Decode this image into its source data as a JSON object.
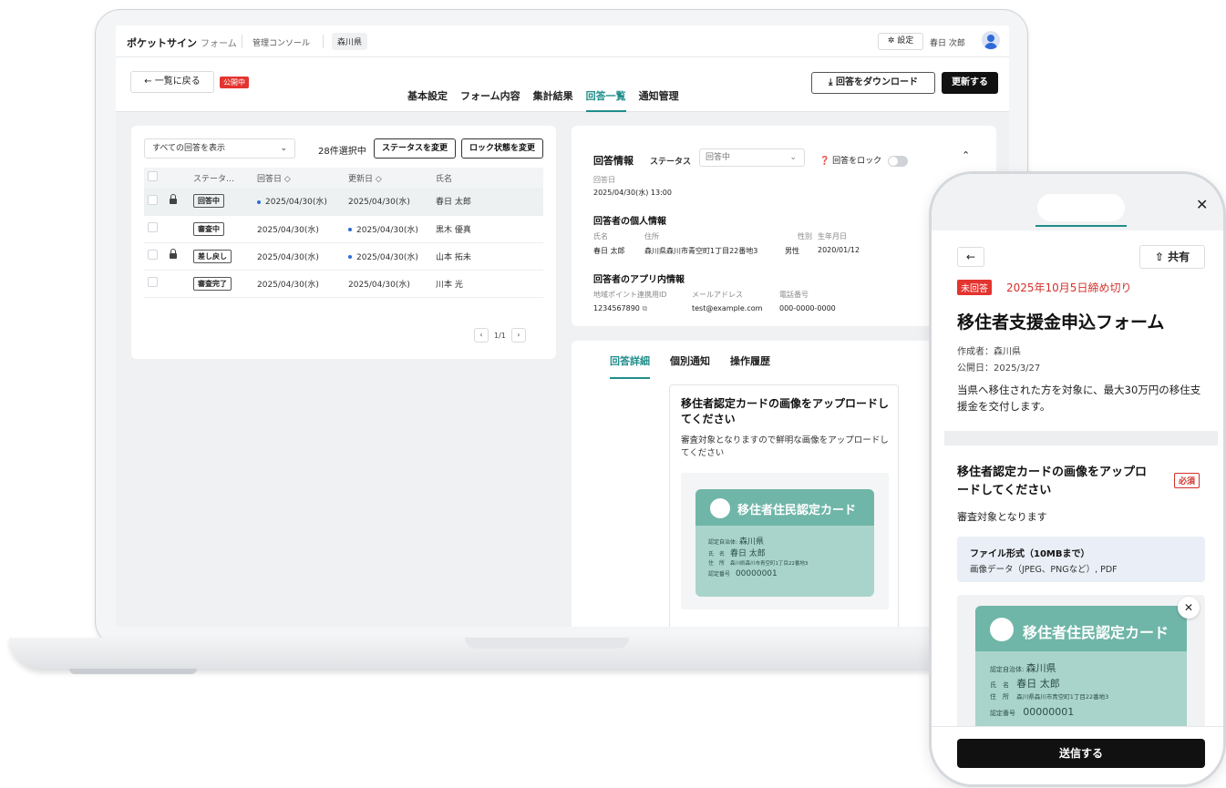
{
  "app": {
    "brand": "ポケットサイン",
    "brand_sub": "フォーム",
    "console": "管理コンソール",
    "prefecture": "森川県",
    "settings_label": "設定",
    "settings_icon": "gear-icon",
    "user_name": "春日 次郎"
  },
  "subheader": {
    "back_label": "← 一覧に戻る",
    "public_badge": "公開中",
    "tabs": [
      "基本設定",
      "フォーム内容",
      "集計結果",
      "回答一覧",
      "通知管理"
    ],
    "active_tab": "回答一覧",
    "download_label": "⤓ 回答をダウンロード",
    "update_label": "更新する"
  },
  "list": {
    "filter_value": "すべての回答を表示",
    "selected_count": "28件選択中",
    "change_status_label": "ステータスを変更",
    "change_lock_label": "ロック状態を変更",
    "columns": [
      "ステータ…",
      "回答日 ◇",
      "更新日 ◇",
      "氏名"
    ],
    "rows": [
      {
        "locked": true,
        "status": "回答中",
        "answered": "2025/04/30(水)",
        "updated": "2025/04/30(水)",
        "name": "春日 太郎",
        "dot_on": "answered"
      },
      {
        "locked": false,
        "status": "審査中",
        "answered": "2025/04/30(水)",
        "updated": "2025/04/30(水)",
        "name": "黒木 優真",
        "dot_on": "updated"
      },
      {
        "locked": true,
        "status": "差し戻し",
        "answered": "2025/04/30(水)",
        "updated": "2025/04/30(水)",
        "name": "山本 拓未",
        "dot_on": "updated"
      },
      {
        "locked": false,
        "status": "審査完了",
        "answered": "2025/04/30(水)",
        "updated": "2025/04/30(水)",
        "name": "川本 光",
        "dot_on": ""
      }
    ],
    "pager": "1/1"
  },
  "detail": {
    "title": "回答情報",
    "status_label": "ステータス",
    "status_value": "回答中",
    "lock_label": "回答をロック",
    "answer_date_label": "回答日",
    "answer_date": "2025/04/30(水) 13:00",
    "personal_heading": "回答者の個人情報",
    "name_label": "氏名",
    "address_label": "住所",
    "gender_label": "性別",
    "birth_label": "生年月日",
    "name_value": "春日 太郎",
    "address_value": "森川県森川市青空町1丁目22番地3",
    "gender_value": "男性",
    "birth_value": "2020/01/12",
    "app_heading": "回答者のアプリ内情報",
    "point_id_label": "地域ポイント連携用ID",
    "email_label": "メールアドレス",
    "phone_label": "電話番号",
    "point_id_value": "1234567890",
    "email_value": "test@example.com",
    "phone_value": "000-0000-0000",
    "tabs": [
      "回答詳細",
      "個別通知",
      "操作履歴"
    ],
    "question_title": "移住者認定カードの画像をアップロードしてください",
    "question_desc": "審査対象となりますので鮮明な画像をアップロードしてください"
  },
  "card": {
    "title": "移住者住民認定カード",
    "municipality_label": "認定自治体:",
    "municipality": "森川県",
    "name_label": "氏　名",
    "name": "春日 太郎",
    "address_label": "住　所",
    "address": "森川県森川市青空町1丁目22番地3",
    "number_label": "認定番号",
    "number": "00000001"
  },
  "phone": {
    "share_label": "共有",
    "unanswered_badge": "未回答",
    "deadline": "2025年10月5日締め切り",
    "form_title": "移住者支援金申込フォーム",
    "author": "作成者：森川県",
    "published": "公開日：2025/3/27",
    "description": "当県へ移住された方を対象に、最大30万円の移住支援金を交付します。",
    "question_title": "移住者認定カードの画像をアップロードしてください",
    "required": "必須",
    "question_desc": "審査対象となります",
    "file_format_title": "ファイル形式（10MBまで）",
    "file_format_desc": "画像データ（JPEG、PNGなど）, PDF",
    "submit_label": "送信する"
  },
  "colors": {
    "accent": "#1f8d8a",
    "danger": "#e3342f",
    "card_bg": "#a9d4cb",
    "card_header": "#6fb6a8"
  }
}
